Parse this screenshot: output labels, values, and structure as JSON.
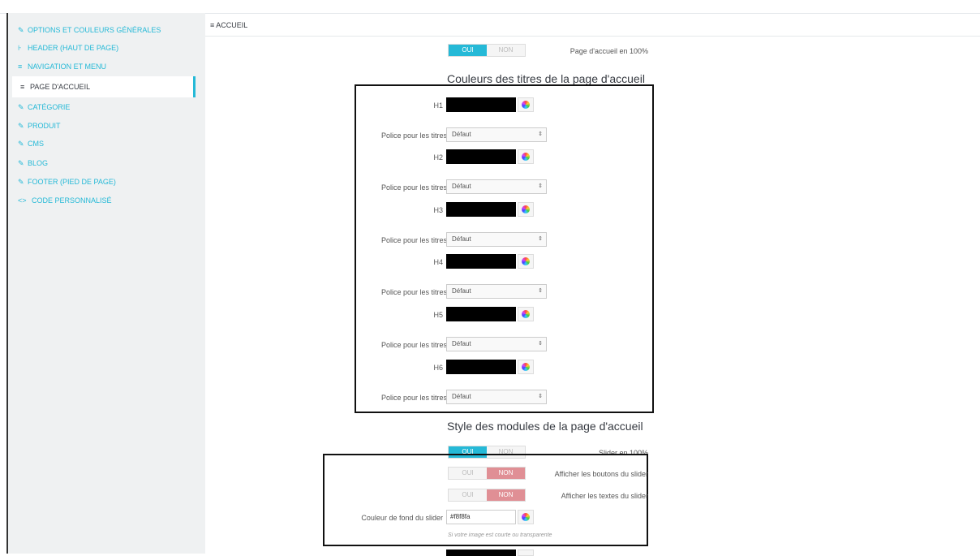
{
  "sidebar": {
    "items": [
      {
        "label": "Options et couleurs générales",
        "icon": "✎"
      },
      {
        "label": "Header (haut de page)",
        "icon": "⊦"
      },
      {
        "label": "Navigation et menu",
        "icon": "≡"
      },
      {
        "label": "Page d'accueil",
        "icon": "≡"
      },
      {
        "label": "Catégorie",
        "icon": "✎"
      },
      {
        "label": "Produit",
        "icon": "✎"
      },
      {
        "label": "CMS",
        "icon": "✎"
      },
      {
        "label": "Blog",
        "icon": "✎"
      },
      {
        "label": "Footer (pied de page)",
        "icon": "✎"
      },
      {
        "label": "Code personnalisé",
        "icon": "<>"
      }
    ]
  },
  "panel": {
    "title": "Accueil",
    "icon": "≡"
  },
  "homepage_full": {
    "label": "Page d'accueil en 100%",
    "yes": "OUI",
    "no": "NON"
  },
  "titles_section": {
    "title": "Couleurs des titres de la page d'accueil",
    "rows": [
      {
        "heading": "H1",
        "font_label": "Police pour les titres",
        "font_value": "Défaut"
      },
      {
        "heading": "H2",
        "font_label": "Police pour les titres",
        "font_value": "Défaut"
      },
      {
        "heading": "H3",
        "font_label": "Police pour les titres",
        "font_value": "Défaut"
      },
      {
        "heading": "H4",
        "font_label": "Police pour les titres",
        "font_value": "Défaut"
      },
      {
        "heading": "H5",
        "font_label": "Police pour les titres",
        "font_value": "Défaut"
      },
      {
        "heading": "H6",
        "font_label": "Police pour les titres",
        "font_value": "Défaut"
      }
    ]
  },
  "modules_section": {
    "title": "Style des modules de la page d'accueil",
    "slider_full": {
      "label": "Slider en 100%",
      "yes": "OUI",
      "no": "NON"
    },
    "slider_buttons": {
      "label": "Afficher les boutons du slider",
      "yes": "OUI",
      "no": "NON"
    },
    "slider_texts": {
      "label": "Afficher les textes du slider",
      "yes": "OUI",
      "no": "NON"
    },
    "slider_bg": {
      "label": "Couleur de fond du slider",
      "value": "#f8f8fa"
    },
    "hint": "Si votre image est courte ou transparente"
  },
  "colors": {
    "accent": "#25b9d7",
    "no_active": "#e08f95",
    "sidebar_bg": "#eff1f2"
  }
}
